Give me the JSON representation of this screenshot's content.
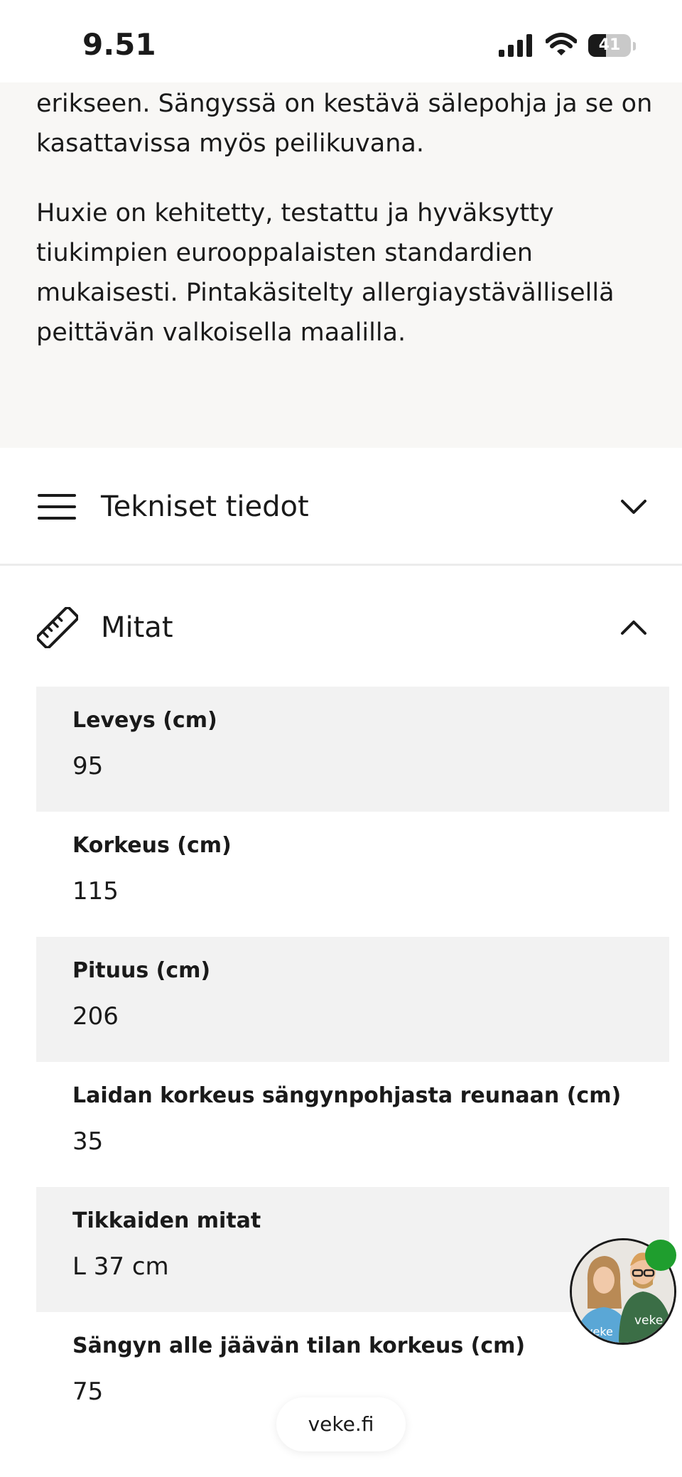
{
  "status_bar": {
    "time": "9.51",
    "battery_level": "41",
    "battery_fraction": 0.41,
    "icons": [
      "cellular-signal-icon",
      "wifi-icon",
      "battery-icon"
    ]
  },
  "description": {
    "paragraph1": "erikseen. Sängyssä on kestävä sälepohja ja se on kasattavissa myös peilikuvana.",
    "paragraph2": "Huxie on kehitetty, testattu ja hyväksytty tiukimpien eurooppalaisten standardien mukaisesti. Pintakäsitelty allergiaystävällisellä peittävän valkoisella maalilla."
  },
  "accordions": {
    "tech": {
      "title": "Tekniset tiedot",
      "icon": "menu-lines-icon",
      "state": "collapsed"
    },
    "dims": {
      "title": "Mitat",
      "icon": "ruler-icon",
      "state": "expanded"
    }
  },
  "dimensions": [
    {
      "label": "Leveys (cm)",
      "value": "95"
    },
    {
      "label": "Korkeus (cm)",
      "value": "115"
    },
    {
      "label": "Pituus (cm)",
      "value": "206"
    },
    {
      "label": "Laidan korkeus sängynpohjasta reunaan (cm)",
      "value": "35"
    },
    {
      "label": "Tikkaiden mitat",
      "value": "L 37 cm"
    },
    {
      "label": "Sängyn alle jäävän tilan korkeus (cm)",
      "value": "75"
    }
  ],
  "chat_widget": {
    "shirt_text_left": "veke",
    "shirt_text_right": "veke",
    "status": "online"
  },
  "footer": {
    "url": "veke.fi"
  },
  "colors": {
    "description_bg": "#f8f7f5",
    "row_shade": "#f2f2f2",
    "online": "#1f9e2e"
  }
}
